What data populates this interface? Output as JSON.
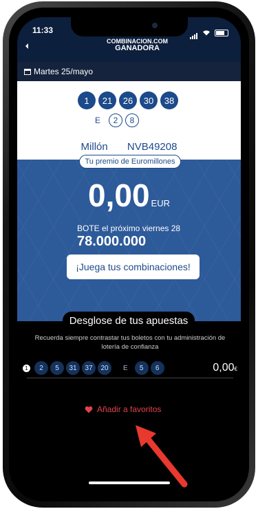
{
  "status": {
    "time": "11:33"
  },
  "logo": {
    "line1": "COMBINACION.COM",
    "line2": "GANADORA"
  },
  "date_label": "Martes 25/mayo",
  "numbers": [
    "1",
    "21",
    "26",
    "30",
    "38"
  ],
  "stars_label": "E",
  "stars": [
    "2",
    "8"
  ],
  "million_label": "Millón",
  "million_code": "NVB49208",
  "prize_pill": "Tu premio de Euromillones",
  "prize_amount": "0,00",
  "prize_currency": "EUR",
  "bote_label": "BOTE el próximo viernes 28",
  "bote_value": "78.000.000",
  "play_button": "¡Juega tus combinaciones!",
  "breakdown_title": "Desglose de tus apuestas",
  "breakdown_note": "Recuerda siempre contrastar tus boletos con tu administración de lotería de confianza",
  "bet_row": {
    "index": "1",
    "numbers": [
      "2",
      "5",
      "31",
      "37",
      "20"
    ],
    "stars_label": "E",
    "stars": [
      "5",
      "6"
    ],
    "amount": "0,00",
    "currency": "€"
  },
  "favorites_label": "Añadir a favoritos",
  "colors": {
    "accent_blue": "#2d5a99",
    "dark_navy": "#0c1f3c",
    "favorite_red": "#e0434b",
    "arrow_red": "#e8392f"
  }
}
